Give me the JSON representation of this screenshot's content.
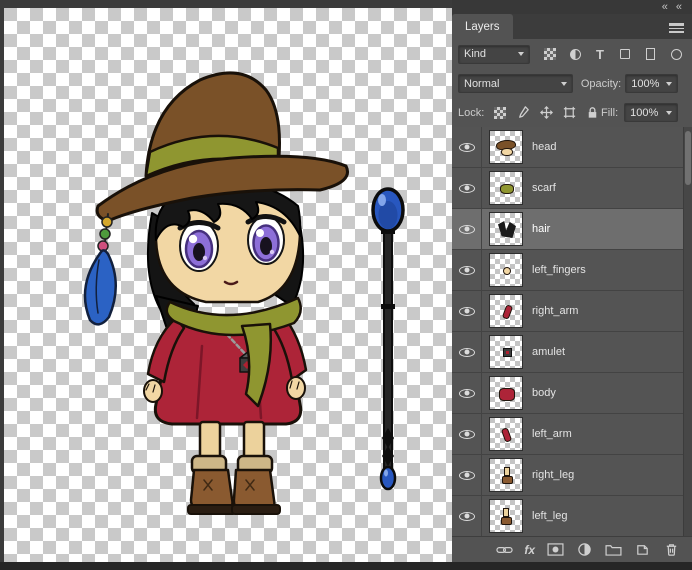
{
  "window": {
    "collapse_icon_glyph": "«"
  },
  "panel": {
    "tab_label": "Layers",
    "filter_row": {
      "kind_label": "Kind",
      "type_filter_glyph": "T"
    },
    "blend_row": {
      "blend_mode": "Normal",
      "opacity_label": "Opacity:",
      "opacity_value": "100%"
    },
    "lock_row": {
      "lock_label": "Lock:",
      "fill_label": "Fill:",
      "fill_value": "100%"
    },
    "layers": [
      {
        "name": "head",
        "visible": true
      },
      {
        "name": "scarf",
        "visible": true
      },
      {
        "name": "hair",
        "visible": true,
        "selected": true
      },
      {
        "name": "left_fingers",
        "visible": true
      },
      {
        "name": "right_arm",
        "visible": true
      },
      {
        "name": "amulet",
        "visible": true
      },
      {
        "name": "body",
        "visible": true
      },
      {
        "name": "left_arm",
        "visible": true
      },
      {
        "name": "right_leg",
        "visible": true
      },
      {
        "name": "left_leg",
        "visible": true
      }
    ],
    "selected_layer": "hair",
    "bottom_bar": {
      "fx_label": "fx"
    }
  },
  "colors": {
    "panel_bg": "#535353",
    "selected_row_bg": "#6e6e6e",
    "canvas_checker": "#c9c9c9",
    "hat_brown": "#7a5128",
    "scarf_olive": "#8f9630",
    "dress_red": "#ad2438",
    "skin_tan": "#f2d7a4",
    "eye_purple": "#8d6fd8",
    "staff_orb_blue": "#2857bf"
  }
}
